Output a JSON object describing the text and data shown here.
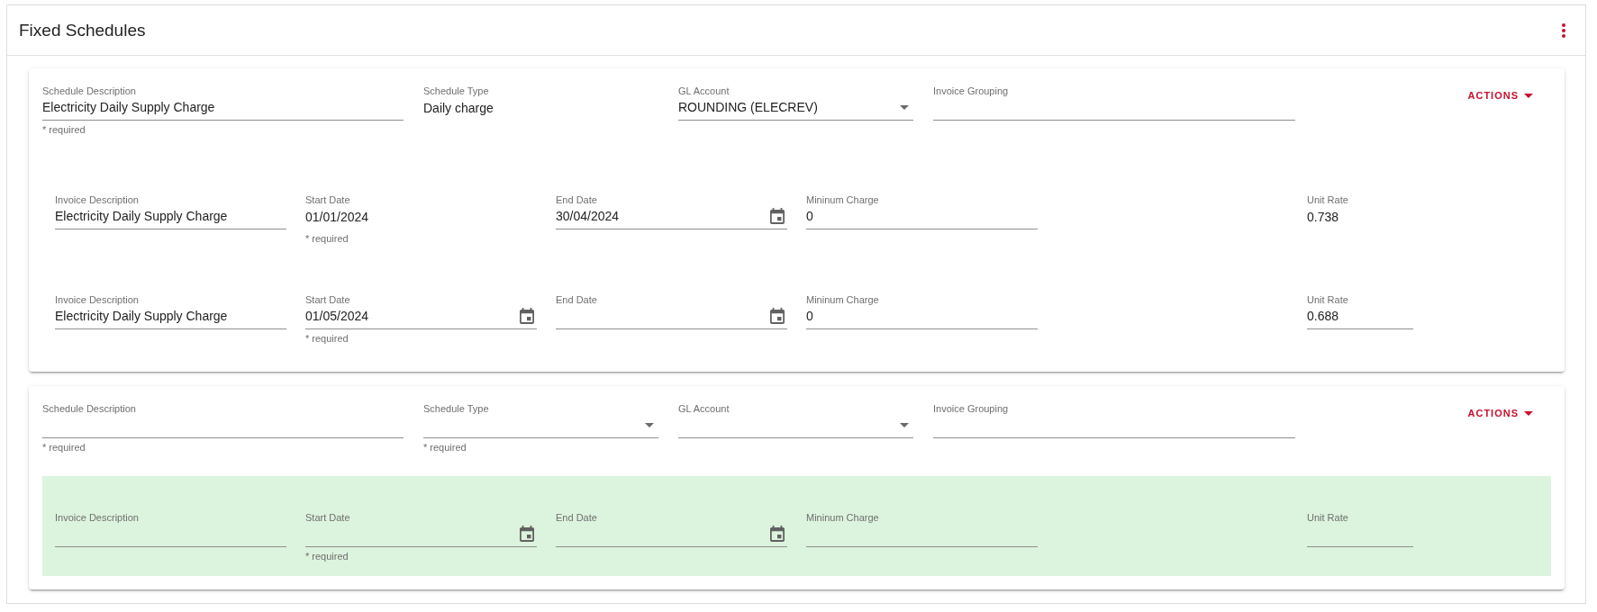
{
  "panel": {
    "title": "Fixed Schedules"
  },
  "schedules": [
    {
      "fields": [
        {
          "kind": "text",
          "label": "Schedule Description",
          "value": "Electricity Daily Supply Charge",
          "helper": "* required"
        },
        {
          "kind": "readonly",
          "label": "Schedule Type",
          "value": "Daily charge"
        },
        {
          "kind": "select",
          "label": "GL Account",
          "value": "ROUNDING (ELECREV)"
        },
        {
          "kind": "text",
          "label": "Invoice Grouping"
        }
      ],
      "actions": {
        "label": "ACTIONS"
      },
      "lines": [
        {
          "highlighted": false,
          "fields": [
            {
              "kind": "text",
              "label": "Invoice Description",
              "value": "Electricity Daily Supply Charge"
            },
            {
              "kind": "readonly",
              "label": "Start Date",
              "value": "01/01/2024",
              "helper": "* required"
            },
            {
              "kind": "date",
              "label": "End Date",
              "value": "30/04/2024"
            },
            {
              "kind": "text",
              "label": "Mininum Charge",
              "value": "0"
            },
            {
              "kind": "readonly",
              "label": "Unit Rate",
              "value": "0.738"
            }
          ]
        },
        {
          "highlighted": false,
          "fields": [
            {
              "kind": "text",
              "label": "Invoice Description",
              "value": "Electricity Daily Supply Charge"
            },
            {
              "kind": "date",
              "label": "Start Date",
              "value": "01/05/2024",
              "helper": "* required"
            },
            {
              "kind": "date",
              "label": "End Date"
            },
            {
              "kind": "text",
              "label": "Mininum Charge",
              "value": "0"
            },
            {
              "kind": "text",
              "label": "Unit Rate",
              "value": "0.688"
            }
          ]
        }
      ]
    },
    {
      "fields": [
        {
          "kind": "text",
          "label": "Schedule Description",
          "helper": "* required"
        },
        {
          "kind": "select",
          "label": "Schedule Type",
          "helper": "* required"
        },
        {
          "kind": "select",
          "label": "GL Account"
        },
        {
          "kind": "text",
          "label": "Invoice Grouping"
        }
      ],
      "actions": {
        "label": "ACTIONS"
      },
      "lines": [
        {
          "highlighted": true,
          "fields": [
            {
              "kind": "text",
              "label": "Invoice Description"
            },
            {
              "kind": "date",
              "label": "Start Date",
              "helper": "* required"
            },
            {
              "kind": "date",
              "label": "End Date"
            },
            {
              "kind": "text",
              "label": "Mininum Charge"
            },
            {
              "kind": "text",
              "label": "Unit Rate"
            }
          ]
        }
      ]
    }
  ]
}
